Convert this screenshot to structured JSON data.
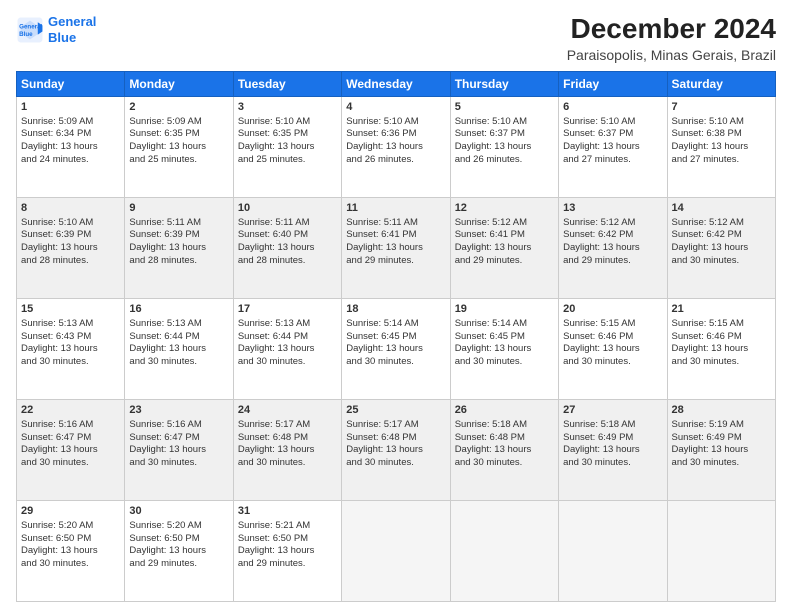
{
  "logo": {
    "line1": "General",
    "line2": "Blue"
  },
  "title": "December 2024",
  "subtitle": "Paraisopolis, Minas Gerais, Brazil",
  "days_header": [
    "Sunday",
    "Monday",
    "Tuesday",
    "Wednesday",
    "Thursday",
    "Friday",
    "Saturday"
  ],
  "weeks": [
    [
      {
        "num": "1",
        "rise": "5:09 AM",
        "set": "6:34 PM",
        "daylight": "13 hours and 24 minutes."
      },
      {
        "num": "2",
        "rise": "5:09 AM",
        "set": "6:35 PM",
        "daylight": "13 hours and 25 minutes."
      },
      {
        "num": "3",
        "rise": "5:10 AM",
        "set": "6:35 PM",
        "daylight": "13 hours and 25 minutes."
      },
      {
        "num": "4",
        "rise": "5:10 AM",
        "set": "6:36 PM",
        "daylight": "13 hours and 26 minutes."
      },
      {
        "num": "5",
        "rise": "5:10 AM",
        "set": "6:37 PM",
        "daylight": "13 hours and 26 minutes."
      },
      {
        "num": "6",
        "rise": "5:10 AM",
        "set": "6:37 PM",
        "daylight": "13 hours and 27 minutes."
      },
      {
        "num": "7",
        "rise": "5:10 AM",
        "set": "6:38 PM",
        "daylight": "13 hours and 27 minutes."
      }
    ],
    [
      {
        "num": "8",
        "rise": "5:10 AM",
        "set": "6:39 PM",
        "daylight": "13 hours and 28 minutes."
      },
      {
        "num": "9",
        "rise": "5:11 AM",
        "set": "6:39 PM",
        "daylight": "13 hours and 28 minutes."
      },
      {
        "num": "10",
        "rise": "5:11 AM",
        "set": "6:40 PM",
        "daylight": "13 hours and 28 minutes."
      },
      {
        "num": "11",
        "rise": "5:11 AM",
        "set": "6:41 PM",
        "daylight": "13 hours and 29 minutes."
      },
      {
        "num": "12",
        "rise": "5:12 AM",
        "set": "6:41 PM",
        "daylight": "13 hours and 29 minutes."
      },
      {
        "num": "13",
        "rise": "5:12 AM",
        "set": "6:42 PM",
        "daylight": "13 hours and 29 minutes."
      },
      {
        "num": "14",
        "rise": "5:12 AM",
        "set": "6:42 PM",
        "daylight": "13 hours and 30 minutes."
      }
    ],
    [
      {
        "num": "15",
        "rise": "5:13 AM",
        "set": "6:43 PM",
        "daylight": "13 hours and 30 minutes."
      },
      {
        "num": "16",
        "rise": "5:13 AM",
        "set": "6:44 PM",
        "daylight": "13 hours and 30 minutes."
      },
      {
        "num": "17",
        "rise": "5:13 AM",
        "set": "6:44 PM",
        "daylight": "13 hours and 30 minutes."
      },
      {
        "num": "18",
        "rise": "5:14 AM",
        "set": "6:45 PM",
        "daylight": "13 hours and 30 minutes."
      },
      {
        "num": "19",
        "rise": "5:14 AM",
        "set": "6:45 PM",
        "daylight": "13 hours and 30 minutes."
      },
      {
        "num": "20",
        "rise": "5:15 AM",
        "set": "6:46 PM",
        "daylight": "13 hours and 30 minutes."
      },
      {
        "num": "21",
        "rise": "5:15 AM",
        "set": "6:46 PM",
        "daylight": "13 hours and 30 minutes."
      }
    ],
    [
      {
        "num": "22",
        "rise": "5:16 AM",
        "set": "6:47 PM",
        "daylight": "13 hours and 30 minutes."
      },
      {
        "num": "23",
        "rise": "5:16 AM",
        "set": "6:47 PM",
        "daylight": "13 hours and 30 minutes."
      },
      {
        "num": "24",
        "rise": "5:17 AM",
        "set": "6:48 PM",
        "daylight": "13 hours and 30 minutes."
      },
      {
        "num": "25",
        "rise": "5:17 AM",
        "set": "6:48 PM",
        "daylight": "13 hours and 30 minutes."
      },
      {
        "num": "26",
        "rise": "5:18 AM",
        "set": "6:48 PM",
        "daylight": "13 hours and 30 minutes."
      },
      {
        "num": "27",
        "rise": "5:18 AM",
        "set": "6:49 PM",
        "daylight": "13 hours and 30 minutes."
      },
      {
        "num": "28",
        "rise": "5:19 AM",
        "set": "6:49 PM",
        "daylight": "13 hours and 30 minutes."
      }
    ],
    [
      {
        "num": "29",
        "rise": "5:20 AM",
        "set": "6:50 PM",
        "daylight": "13 hours and 30 minutes."
      },
      {
        "num": "30",
        "rise": "5:20 AM",
        "set": "6:50 PM",
        "daylight": "13 hours and 29 minutes."
      },
      {
        "num": "31",
        "rise": "5:21 AM",
        "set": "6:50 PM",
        "daylight": "13 hours and 29 minutes."
      },
      null,
      null,
      null,
      null
    ]
  ],
  "labels": {
    "sunrise": "Sunrise:",
    "sunset": "Sunset:",
    "daylight": "Daylight:"
  }
}
